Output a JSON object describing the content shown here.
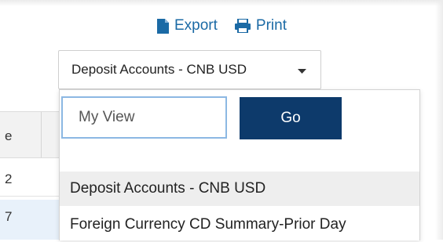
{
  "toolbar": {
    "export_label": "Export",
    "print_label": "Print"
  },
  "view_select": {
    "selected": "Deposit Accounts - CNB USD"
  },
  "grid": {
    "header_fragment": "e",
    "rows": [
      "2",
      "7"
    ]
  },
  "dropdown": {
    "view_name_value": "My View",
    "go_label": "Go",
    "options": [
      "Deposit Accounts - CNB USD",
      "Foreign Currency CD Summary-Prior Day"
    ],
    "selected_index": 0
  },
  "colors": {
    "link": "#1b6aa5",
    "button": "#0d3a6b",
    "focus_border": "#8cb8e3",
    "selected_option_bg": "#eeeeee",
    "highlight_row": "#e8f1fa"
  },
  "icons": {
    "export": "file-icon",
    "print": "printer-icon",
    "select_caret": "caret-down-icon"
  }
}
